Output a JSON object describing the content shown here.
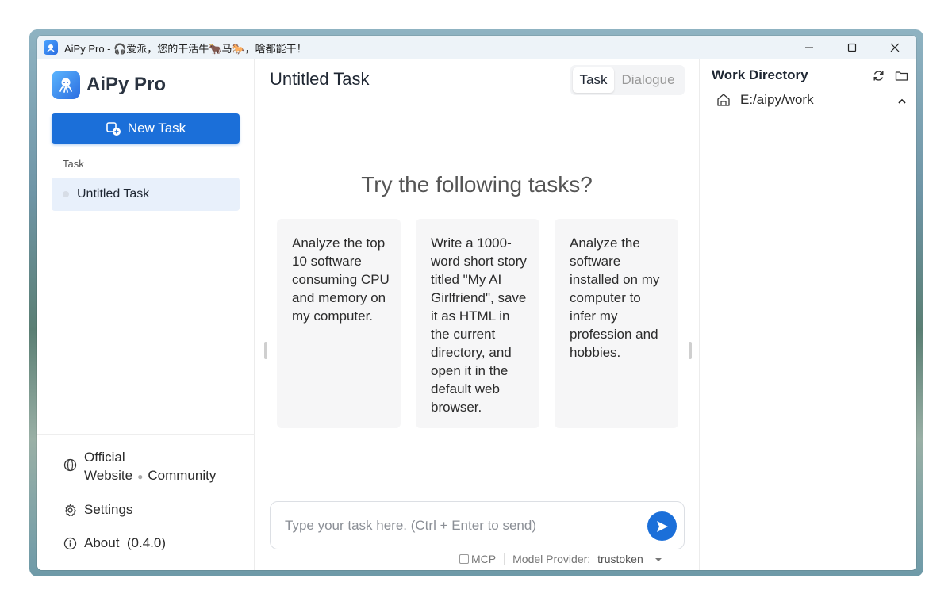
{
  "window": {
    "title": "AiPy Pro - 🎧爱派，您的干活牛🐂马🐎，啥都能干！"
  },
  "sidebar": {
    "logo_text": "AiPy Pro",
    "new_task_label": "New Task",
    "section_label": "Task",
    "tasks": [
      {
        "label": "Untitled Task"
      }
    ],
    "footer": {
      "official_line1": "Official",
      "official_line2": "Website",
      "community": "Community",
      "settings": "Settings",
      "about": "About  (0.4.0)"
    }
  },
  "main": {
    "title": "Untitled Task",
    "tabs": [
      {
        "label": "Task",
        "active": true
      },
      {
        "label": "Dialogue",
        "active": false
      }
    ],
    "heading": "Try the following tasks?",
    "suggestions": [
      {
        "text": "Analyze the top 10 software consuming CPU and memory on my computer."
      },
      {
        "text": "Write a 1000-word short story titled \"My AI Girlfriend\", save it as HTML in the current directory, and open it in the default web browser."
      },
      {
        "text": "Analyze the software installed on my computer to infer my profession and hobbies."
      }
    ],
    "input": {
      "placeholder": "Type your task here. (Ctrl + Enter to send)",
      "value": ""
    },
    "bottom": {
      "mcp_label": "MCP",
      "provider_label": "Model Provider:",
      "provider_value": "trustoken"
    }
  },
  "right_panel": {
    "title": "Work Directory",
    "directory": "E:/aipy/work"
  },
  "colors": {
    "accent": "#1b6fd9",
    "task_item_bg": "#e8f0fb",
    "card_bg": "#f6f6f7"
  }
}
